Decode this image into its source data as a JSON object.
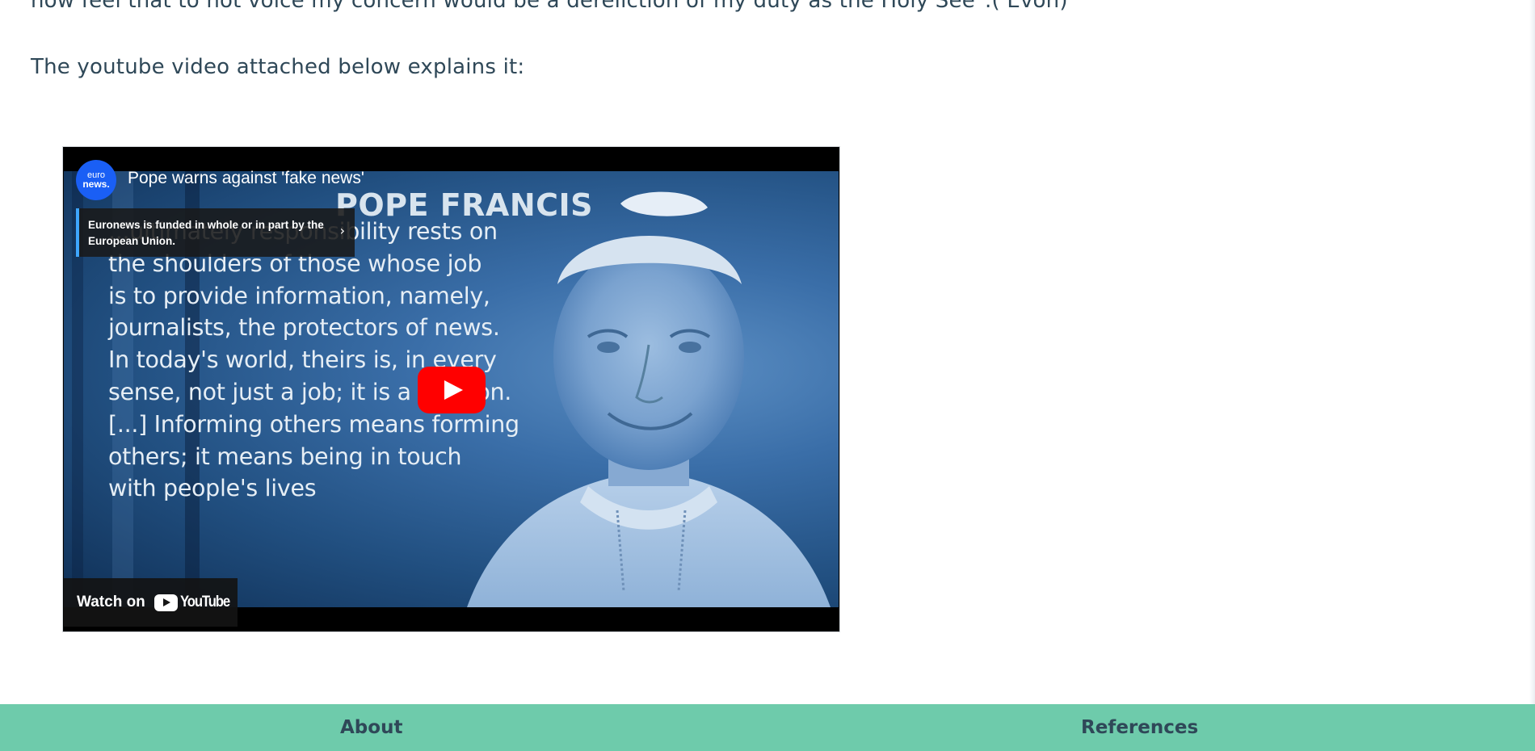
{
  "article": {
    "partial_line": "now feel that to not voice my concern would be a dereliction of my duty as the Holy See\".( Evon)",
    "video_intro": "The youtube video attached below explains it:"
  },
  "video": {
    "channel_logo_line1": "euro",
    "channel_logo_line2": "news.",
    "title": "Pope warns against 'fake news'",
    "funding_notice": "Euronews is funded in whole or in part by the European Union.",
    "funding_arrow": "›",
    "thumbnail": {
      "heading": "POPE FRANCIS",
      "quote_lines": [
        "...ultimately responsibility rests on",
        "the shoulders of those whose job",
        "is to provide information, namely,",
        "journalists, the protectors of news.",
        "In today's world, theirs is, in every",
        "sense, not just a job; it is a mission.",
        "[...] Informing others means forming",
        "others; it means being in touch",
        "with people's lives"
      ]
    },
    "watch_on_label": "Watch on",
    "youtube_wordmark": "YouTube",
    "colors": {
      "play_button": "#ff0000",
      "channel_logo": "#1a5ff5"
    }
  },
  "footer": {
    "about": "About",
    "references": "References",
    "background_color": "#6ecbab",
    "text_color": "#2f4858"
  }
}
